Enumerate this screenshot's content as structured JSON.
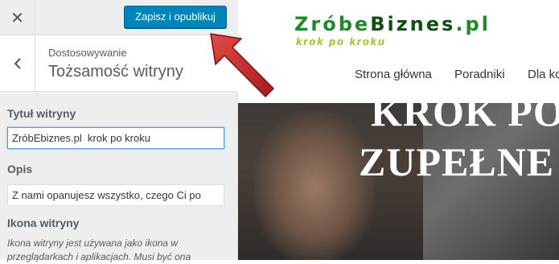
{
  "sidebar": {
    "close_icon_glyph": "✕",
    "publish_label": "Zapisz i opublikuj",
    "breadcrumb": "Dostosowywanie",
    "section_title": "Tożsamość witryny",
    "controls": {
      "site_title": {
        "label": "Tytuł witryny",
        "value": "ZróbEbiznes.pl  krok po kroku"
      },
      "tagline": {
        "label": "Opis",
        "value": "Z nami opanujesz wszystko, czego Ci po"
      },
      "site_icon": {
        "label": "Ikona witryny",
        "description": "Ikona witryny jest używana jako ikona w przeglądarkach i aplikacjach. Musi być ona"
      }
    },
    "accent_color": "#0085ba"
  },
  "preview": {
    "logo": {
      "part1": "Zróbe",
      "part2": "Biznes",
      "part3": ".pl",
      "tagline": "krok po kroku"
    },
    "nav": [
      "Strona główna",
      "Poradniki",
      "Dla ko"
    ],
    "hero": {
      "line1": "KROK PO",
      "line2": "ZUPEŁNE"
    }
  },
  "annotation": {
    "arrow_color": "#cc2a2a"
  }
}
